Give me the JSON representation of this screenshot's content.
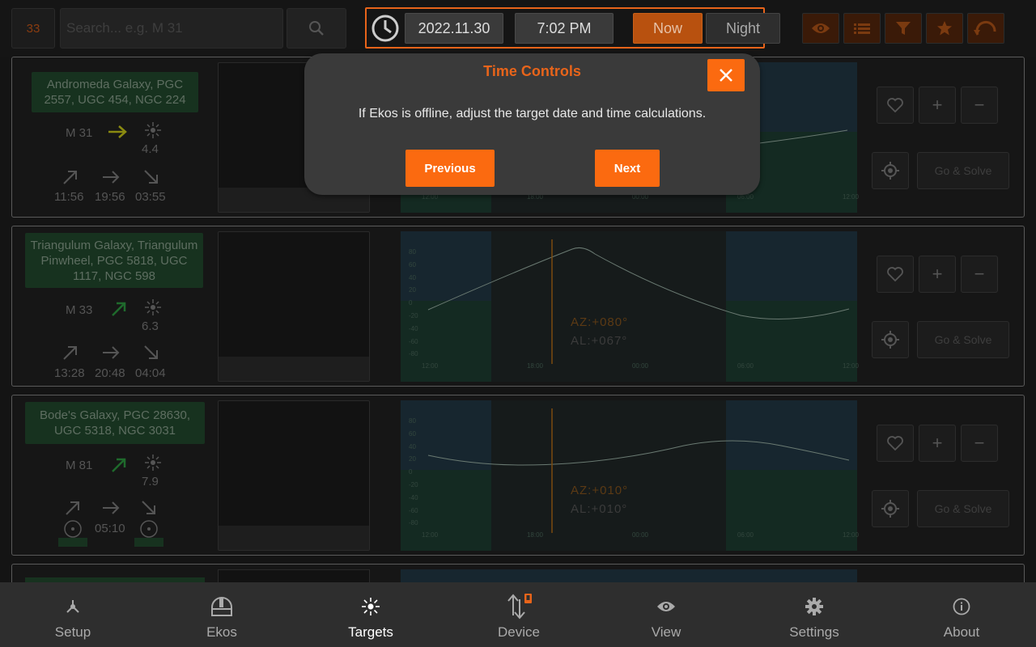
{
  "topbar": {
    "count": "33",
    "search_placeholder": "Search... e.g. M 31",
    "date": "2022.11.30",
    "time": "7:02 PM",
    "now_label": "Now",
    "night_label": "Night",
    "icons": [
      "search-icon",
      "clock-icon",
      "eye-icon",
      "list-icon",
      "filter-icon",
      "star-icon",
      "undo-icon"
    ]
  },
  "targets": [
    {
      "name": "Andromeda Galaxy, PGC 2557, UGC 454, NGC 224",
      "id": "M 31",
      "magnitude": "4.4",
      "rise": "11:56",
      "transit": "19:56",
      "set": "03:55",
      "go_solve": "Go & Solve"
    },
    {
      "name": "Triangulum Galaxy, Triangulum Pinwheel, PGC 5818, UGC 1117, NGC 598",
      "id": "M 33",
      "magnitude": "6.3",
      "rise": "13:28",
      "transit": "20:48",
      "set": "04:04",
      "az": "AZ:+080°",
      "al": "AL:+067°",
      "go_solve": "Go & Solve"
    },
    {
      "name": "Bode's Galaxy, PGC 28630, UGC 5318, NGC 3031",
      "id": "M 81",
      "magnitude": "7.9",
      "transit": "05:10",
      "az": "AZ:+010°",
      "al": "AL:+010°",
      "go_solve": "Go & Solve"
    }
  ],
  "chart_axis": {
    "y_ticks": [
      "80",
      "60",
      "40",
      "20",
      "0",
      "-20",
      "-40",
      "-60",
      "-80"
    ],
    "x_ticks": [
      "12:00",
      "18:00",
      "00:00",
      "06:00",
      "12:00"
    ]
  },
  "modal": {
    "title": "Time Controls",
    "message": "If Ekos is offline, adjust the target date and time calculations.",
    "previous_label": "Previous",
    "next_label": "Next"
  },
  "nav": [
    {
      "label": "Setup",
      "icon": "setup-icon"
    },
    {
      "label": "Ekos",
      "icon": "ekos-icon"
    },
    {
      "label": "Targets",
      "icon": "targets-icon",
      "active": true
    },
    {
      "label": "Device",
      "icon": "device-icon"
    },
    {
      "label": "View",
      "icon": "view-icon"
    },
    {
      "label": "Settings",
      "icon": "settings-icon"
    },
    {
      "label": "About",
      "icon": "about-icon"
    }
  ],
  "colors": {
    "accent": "#fb6a10",
    "background": "#141414",
    "nav_background": "#2e2e2e"
  }
}
